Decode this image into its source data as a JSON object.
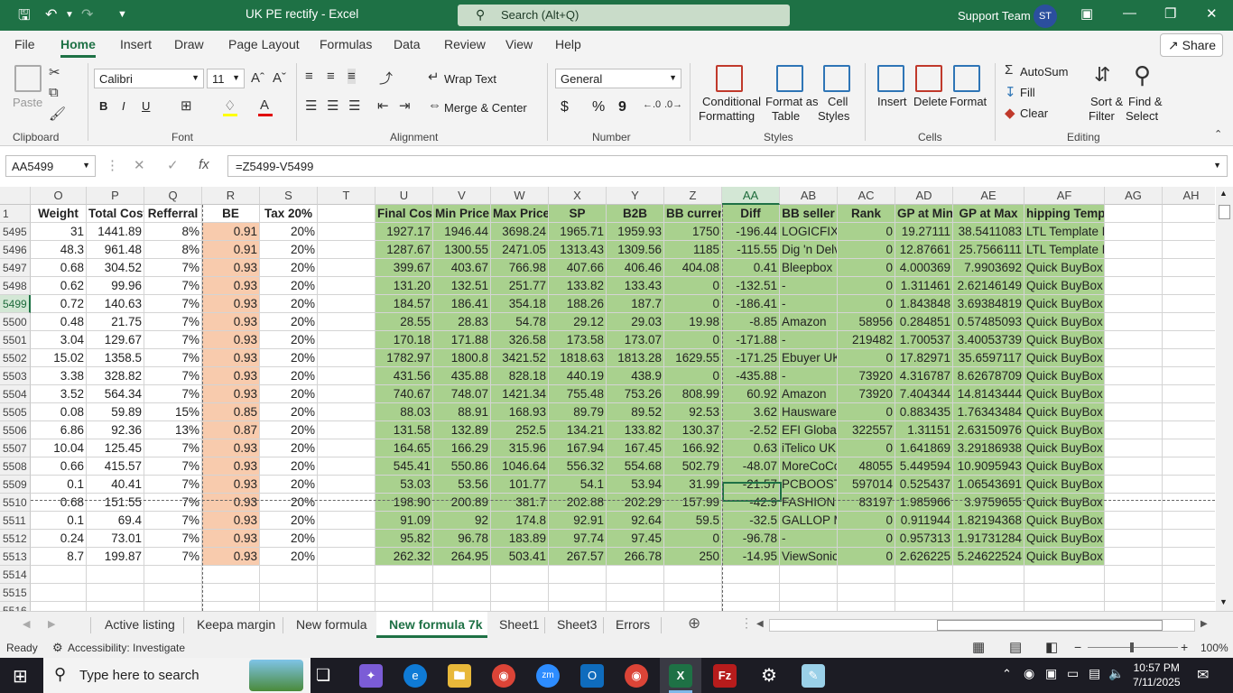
{
  "window": {
    "title": "UK PE rectify  -  Excel",
    "search_placeholder": "Search (Alt+Q)",
    "user_name": "Support Team",
    "user_initials": "ST"
  },
  "ribbon_tabs": [
    "File",
    "Home",
    "Insert",
    "Draw",
    "Page Layout",
    "Formulas",
    "Data",
    "Review",
    "View",
    "Help"
  ],
  "active_ribbon_tab": "Home",
  "share_label": "Share",
  "ribbon": {
    "clipboard": {
      "label": "Clipboard",
      "paste": "Paste"
    },
    "font": {
      "label": "Font",
      "name": "Calibri",
      "size": "11",
      "bold": "B",
      "italic": "I",
      "underline": "U"
    },
    "alignment": {
      "label": "Alignment",
      "wrap_text": "Wrap Text",
      "merge_center": "Merge & Center"
    },
    "number": {
      "label": "Number",
      "format": "General",
      "currency": "$",
      "percent": "%",
      "comma": "9"
    },
    "styles": {
      "label": "Styles",
      "conditional_1": "Conditional",
      "conditional_2": "Formatting",
      "format_table_1": "Format as",
      "format_table_2": "Table",
      "cell_styles_1": "Cell",
      "cell_styles_2": "Styles"
    },
    "cells": {
      "label": "Cells",
      "insert": "Insert",
      "delete": "Delete",
      "format": "Format"
    },
    "editing": {
      "label": "Editing",
      "autosum": "AutoSum",
      "fill": "Fill",
      "clear": "Clear",
      "sort_1": "Sort &",
      "sort_2": "Filter",
      "find_1": "Find &",
      "find_2": "Select"
    }
  },
  "formula_bar": {
    "name_box": "AA5499",
    "formula": "=Z5499-V5499"
  },
  "columns": [
    "O",
    "P",
    "Q",
    "R",
    "S",
    "T",
    "U",
    "V",
    "W",
    "X",
    "Y",
    "Z",
    "AA",
    "AB",
    "AC",
    "AD",
    "AE",
    "AF",
    "AG",
    "AH"
  ],
  "header_row": {
    "row_number": "1",
    "cells": [
      "Weight",
      "Total Cost",
      "Refferral",
      "BE",
      "Tax 20%",
      "",
      "Final Cost",
      "Min Price",
      "Max Price",
      "SP",
      "B2B",
      "BB current",
      "Diff",
      "BB seller",
      "Rank",
      "GP at Min",
      "GP at Max",
      "hipping Template",
      "",
      ""
    ]
  },
  "rows": [
    {
      "n": "5495",
      "c": [
        "31",
        "1441.89",
        "8%",
        "0.91",
        "20%",
        "",
        "1927.17",
        "1946.44",
        "3698.24",
        "1965.71",
        "1959.93",
        "1750",
        "-196.44",
        "LOGICFIX L",
        "0",
        "19.27111",
        "38.5411083",
        "LTL Template Paid",
        "",
        ""
      ]
    },
    {
      "n": "5496",
      "c": [
        "48.3",
        "961.48",
        "8%",
        "0.91",
        "20%",
        "",
        "1287.67",
        "1300.55",
        "2471.05",
        "1313.43",
        "1309.56",
        "1185",
        "-115.55",
        "Dig 'n Delv",
        "0",
        "12.87661",
        "25.7566111",
        "LTL Template Paid",
        "",
        ""
      ]
    },
    {
      "n": "5497",
      "c": [
        "0.68",
        "304.52",
        "7%",
        "0.93",
        "20%",
        "",
        "399.67",
        "403.67",
        "766.98",
        "407.66",
        "406.46",
        "404.08",
        "0.41",
        "Bleepbox",
        "0",
        "4.000369",
        "7.9903692",
        "Quick BuyBox Freeship",
        "",
        ""
      ]
    },
    {
      "n": "5498",
      "c": [
        "0.62",
        "99.96",
        "7%",
        "0.93",
        "20%",
        "",
        "131.20",
        "132.51",
        "251.77",
        "133.82",
        "133.43",
        "0",
        "-132.51",
        "-",
        "0",
        "1.311461",
        "2.62146149",
        "Quick BuyBox Freeship",
        "",
        ""
      ]
    },
    {
      "n": "5499",
      "c": [
        "0.72",
        "140.63",
        "7%",
        "0.93",
        "20%",
        "",
        "184.57",
        "186.41",
        "354.18",
        "188.26",
        "187.7",
        "0",
        "-186.41",
        "-",
        "0",
        "1.843848",
        "3.69384819",
        "Quick BuyBox Freeship",
        "",
        ""
      ]
    },
    {
      "n": "5500",
      "c": [
        "0.48",
        "21.75",
        "7%",
        "0.93",
        "20%",
        "",
        "28.55",
        "28.83",
        "54.78",
        "29.12",
        "29.03",
        "19.98",
        "-8.85",
        "Amazon",
        "58956",
        "0.284851",
        "0.57485093",
        "Quick BuyBox Freeship",
        "",
        ""
      ]
    },
    {
      "n": "5501",
      "c": [
        "3.04",
        "129.67",
        "7%",
        "0.93",
        "20%",
        "",
        "170.18",
        "171.88",
        "326.58",
        "173.58",
        "173.07",
        "0",
        "-171.88",
        "-",
        "219482",
        "1.700537",
        "3.40053739",
        "Quick BuyBox Freeship",
        "",
        ""
      ]
    },
    {
      "n": "5502",
      "c": [
        "15.02",
        "1358.5",
        "7%",
        "0.93",
        "20%",
        "",
        "1782.97",
        "1800.8",
        "3421.52",
        "1818.63",
        "1813.28",
        "1629.55",
        "-171.25",
        "Ebuyer UK",
        "0",
        "17.82971",
        "35.6597117",
        "Quick BuyBox Freeship",
        "",
        ""
      ]
    },
    {
      "n": "5503",
      "c": [
        "3.38",
        "328.82",
        "7%",
        "0.93",
        "20%",
        "",
        "431.56",
        "435.88",
        "828.18",
        "440.19",
        "438.9",
        "0",
        "-435.88",
        "-",
        "73920",
        "4.316787",
        "8.62678709",
        "Quick BuyBox Freeship",
        "",
        ""
      ]
    },
    {
      "n": "5504",
      "c": [
        "3.52",
        "564.34",
        "7%",
        "0.93",
        "20%",
        "",
        "740.67",
        "748.07",
        "1421.34",
        "755.48",
        "753.26",
        "808.99",
        "60.92",
        "Amazon",
        "73920",
        "7.404344",
        "14.8143444",
        "Quick BuyBox Freeship",
        "",
        ""
      ]
    },
    {
      "n": "5505",
      "c": [
        "0.08",
        "59.89",
        "15%",
        "0.85",
        "20%",
        "",
        "88.03",
        "88.91",
        "168.93",
        "89.79",
        "89.52",
        "92.53",
        "3.62",
        "Hausware",
        "0",
        "0.883435",
        "1.76343484",
        "Quick BuyBox Freeship",
        "",
        ""
      ]
    },
    {
      "n": "5506",
      "c": [
        "6.86",
        "92.36",
        "13%",
        "0.87",
        "20%",
        "",
        "131.58",
        "132.89",
        "252.5",
        "134.21",
        "133.82",
        "130.37",
        "-2.52",
        "EFI Global",
        "322557",
        "1.31151",
        "2.63150976",
        "Quick BuyBox Freeship",
        "",
        ""
      ]
    },
    {
      "n": "5507",
      "c": [
        "10.04",
        "125.45",
        "7%",
        "0.93",
        "20%",
        "",
        "164.65",
        "166.29",
        "315.96",
        "167.94",
        "167.45",
        "166.92",
        "0.63",
        "iTelico UK",
        "0",
        "1.641869",
        "3.29186938",
        "Quick BuyBox Freeship",
        "",
        ""
      ]
    },
    {
      "n": "5508",
      "c": [
        "0.66",
        "415.57",
        "7%",
        "0.93",
        "20%",
        "",
        "545.41",
        "550.86",
        "1046.64",
        "556.32",
        "554.68",
        "502.79",
        "-48.07",
        "MoreCoCo",
        "48055",
        "5.449594",
        "10.9095943",
        "Quick BuyBox Freeship",
        "",
        ""
      ]
    },
    {
      "n": "5509",
      "c": [
        "0.1",
        "40.41",
        "7%",
        "0.93",
        "20%",
        "",
        "53.03",
        "53.56",
        "101.77",
        "54.1",
        "53.94",
        "31.99",
        "-21.57",
        "PCBOOST",
        "597014",
        "0.525437",
        "1.06543691",
        "Quick BuyBox Freeship",
        "",
        ""
      ]
    },
    {
      "n": "5510",
      "c": [
        "0.68",
        "151.55",
        "7%",
        "0.93",
        "20%",
        "",
        "198.90",
        "200.89",
        "381.7",
        "202.88",
        "202.29",
        "157.99",
        "-42.9",
        "FASHION F",
        "83197",
        "1.985966",
        "3.9759655",
        "Quick BuyBox Freeship",
        "",
        ""
      ]
    },
    {
      "n": "5511",
      "c": [
        "0.1",
        "69.4",
        "7%",
        "0.93",
        "20%",
        "",
        "91.09",
        "92",
        "174.8",
        "92.91",
        "92.64",
        "59.5",
        "-32.5",
        "GALLOP M",
        "0",
        "0.911944",
        "1.82194368",
        "Quick BuyBox Freeship",
        "",
        ""
      ]
    },
    {
      "n": "5512",
      "c": [
        "0.24",
        "73.01",
        "7%",
        "0.93",
        "20%",
        "",
        "95.82",
        "96.78",
        "183.89",
        "97.74",
        "97.45",
        "0",
        "-96.78",
        "-",
        "0",
        "0.957313",
        "1.91731284",
        "Quick BuyBox Freeship",
        "",
        ""
      ]
    },
    {
      "n": "5513",
      "c": [
        "8.7",
        "199.87",
        "7%",
        "0.93",
        "20%",
        "",
        "262.32",
        "264.95",
        "503.41",
        "267.57",
        "266.78",
        "250",
        "-14.95",
        "ViewSonic",
        "0",
        "2.626225",
        "5.24622524",
        "Quick BuyBox Freeship",
        "",
        ""
      ]
    },
    {
      "n": "5514",
      "c": [
        "",
        "",
        "",
        "",
        "",
        "",
        "",
        "",
        "",
        "",
        "",
        "",
        "",
        "",
        "",
        "",
        "",
        "",
        "",
        ""
      ]
    },
    {
      "n": "5515",
      "c": [
        "",
        "",
        "",
        "",
        "",
        "",
        "",
        "",
        "",
        "",
        "",
        "",
        "",
        "",
        "",
        "",
        "",
        "",
        "",
        ""
      ]
    },
    {
      "n": "5516",
      "c": [
        "",
        "",
        "",
        "",
        "",
        "",
        "",
        "",
        "",
        "",
        "",
        "",
        "",
        "",
        "",
        "",
        "",
        "",
        "",
        ""
      ]
    }
  ],
  "selected_cell": "AA5499",
  "sheet_tabs": [
    "Active listing",
    "Keepa margin",
    "New formula",
    "New formula 7k",
    "Sheet1",
    "Sheet3",
    "Errors"
  ],
  "active_sheet": "New formula 7k",
  "status": {
    "ready": "Ready",
    "accessibility": "Accessibility: Investigate",
    "zoom": "100%"
  },
  "taskbar": {
    "search_placeholder": "Type here to search",
    "time": "10:57 PM",
    "date": "7/11/2025"
  },
  "colors": {
    "excel_green": "#1e7145",
    "cell_green": "#a9d18e",
    "cell_orange": "#f8cbad"
  }
}
